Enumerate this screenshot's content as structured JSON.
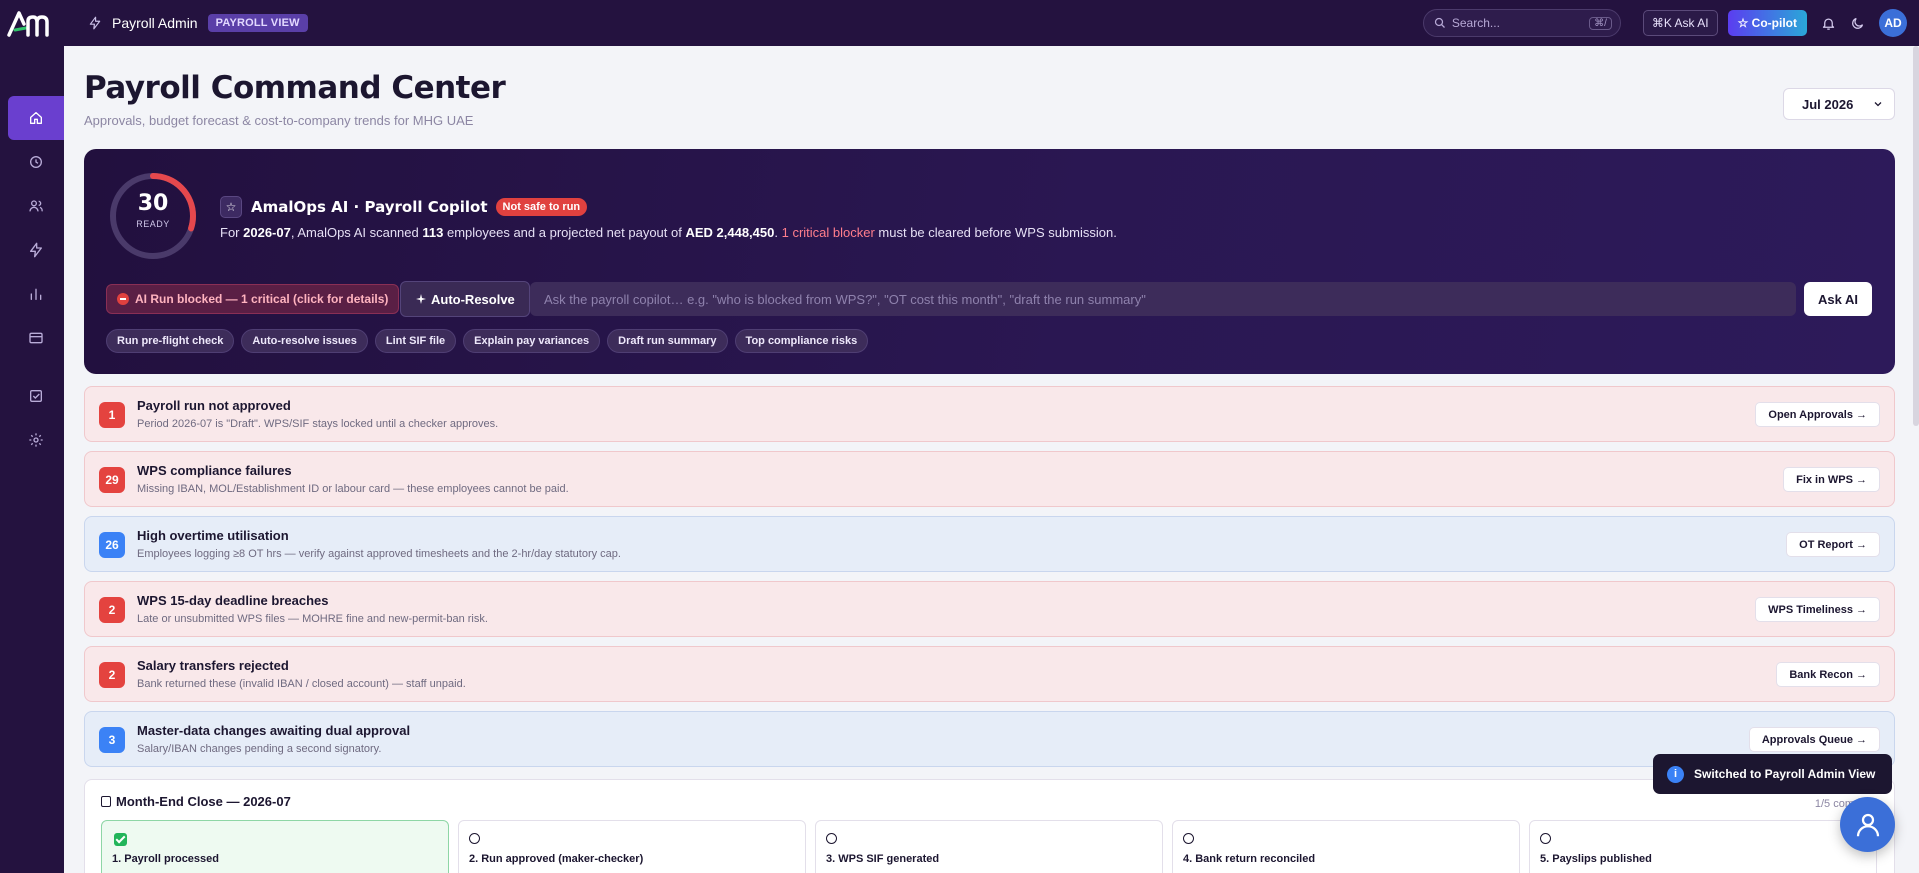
{
  "topbar": {
    "app_title": "Payroll Admin",
    "view_badge": "PAYROLL VIEW",
    "search_placeholder": "Search...",
    "search_kbd": "⌘/",
    "ask_ai_label": "⌘K Ask AI",
    "copilot_label": "☆ Co-pilot",
    "avatar_initials": "AD"
  },
  "sidebar": {
    "items": [
      {
        "icon": "home-icon",
        "active": true
      },
      {
        "icon": "clock-icon"
      },
      {
        "icon": "users-icon"
      },
      {
        "icon": "lightning-icon"
      },
      {
        "icon": "bar-chart-icon"
      },
      {
        "icon": "credit-card-icon"
      },
      {
        "icon": "check-square-icon"
      },
      {
        "icon": "gear-icon"
      }
    ]
  },
  "page": {
    "title": "Payroll Command Center",
    "subtitle": "Approvals, budget forecast & cost-to-company trends for MHG UAE",
    "month": "Jul 2026"
  },
  "copilot": {
    "score": "30",
    "score_label": "READY",
    "score_fraction": 0.3,
    "title": "AmalOps AI · Payroll Copilot",
    "status_badge": "Not safe to run",
    "line_prefix": "For ",
    "period": "2026-07",
    "line_mid1": ", AmalOps AI scanned ",
    "employees": "113",
    "line_mid2": " employees and a projected net payout of ",
    "payout": "AED 2,448,450",
    "line_mid3": ". ",
    "blocker": "1 critical blocker",
    "line_end": " must be cleared before WPS submission.",
    "blocked_label": "AI Run blocked — 1 critical (click for details)",
    "auto_resolve_label": "Auto-Resolve",
    "ask_placeholder": "Ask the payroll copilot… e.g. \"who is blocked from WPS?\", \"OT cost this month\", \"draft the run summary\"",
    "ask_button": "Ask AI",
    "chips": [
      "Run pre-flight check",
      "Auto-resolve issues",
      "Lint SIF file",
      "Explain pay variances",
      "Draft run summary",
      "Top compliance risks"
    ],
    "colors": {
      "accent_ring": "#e5484d",
      "track": "#4a3a6a"
    }
  },
  "alerts": [
    {
      "count": "1",
      "title": "Payroll run not approved",
      "desc": "Period 2026-07 is \"Draft\". WPS/SIF stays locked until a checker approves.",
      "action": "Open Approvals →",
      "tone": "red"
    },
    {
      "count": "29",
      "title": "WPS compliance failures",
      "desc": "Missing IBAN, MOL/Establishment ID or labour card — these employees cannot be paid.",
      "action": "Fix in WPS →",
      "tone": "red"
    },
    {
      "count": "26",
      "title": "High overtime utilisation",
      "desc": "Employees logging ≥8 OT hrs — verify against approved timesheets and the 2-hr/day statutory cap.",
      "action": "OT Report →",
      "tone": "blue"
    },
    {
      "count": "2",
      "title": "WPS 15-day deadline breaches",
      "desc": "Late or unsubmitted WPS files — MOHRE fine and new-permit-ban risk.",
      "action": "WPS Timeliness →",
      "tone": "red"
    },
    {
      "count": "2",
      "title": "Salary transfers rejected",
      "desc": "Bank returned these (invalid IBAN / closed account) — staff unpaid.",
      "action": "Bank Recon →",
      "tone": "red"
    },
    {
      "count": "3",
      "title": "Master-data changes awaiting dual approval",
      "desc": "Salary/IBAN changes pending a second signatory.",
      "action": "Approvals Queue →",
      "tone": "blue"
    }
  ],
  "month_end": {
    "title": "Month-End Close — 2026-07",
    "count": "1/5 com",
    "steps": [
      {
        "label": "1. Payroll processed",
        "done": true
      },
      {
        "label": "2. Run approved (maker-checker)",
        "done": false
      },
      {
        "label": "3. WPS SIF generated",
        "done": false
      },
      {
        "label": "4. Bank return reconciled",
        "done": false
      },
      {
        "label": "5. Payslips published",
        "done": false
      }
    ]
  },
  "toast": {
    "text": "Switched to Payroll Admin View"
  }
}
